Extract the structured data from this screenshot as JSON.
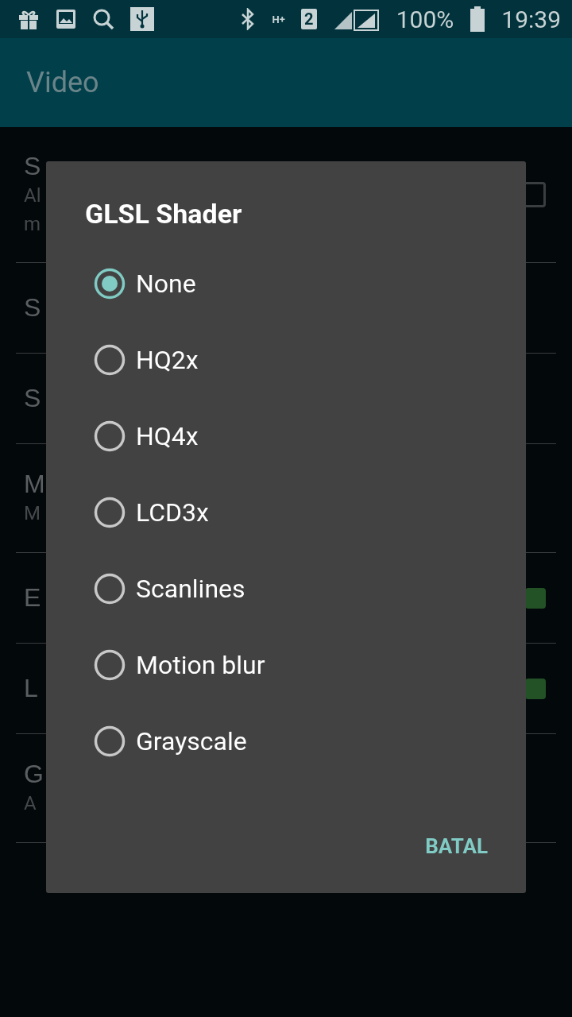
{
  "status_bar": {
    "network": "H+",
    "sim": "2",
    "battery": "100%",
    "time": "19:39"
  },
  "app_bar": {
    "title": "Video"
  },
  "settings": [
    {
      "title": "S",
      "summary": [
        "Al",
        "m"
      ],
      "kind": "checkbox",
      "checked": false
    },
    {
      "title": "S",
      "kind": "plain"
    },
    {
      "title": "S",
      "kind": "plain"
    },
    {
      "title": "M",
      "summary": [
        "M"
      ],
      "kind": "plain"
    },
    {
      "title": "E",
      "kind": "checkbox",
      "checked": true
    },
    {
      "title": "L",
      "kind": "checkbox",
      "checked": true
    },
    {
      "title": "G",
      "summary": [
        "A"
      ],
      "kind": "plain"
    }
  ],
  "dialog": {
    "title": "GLSL Shader",
    "options": [
      {
        "label": "None",
        "selected": true
      },
      {
        "label": "HQ2x",
        "selected": false
      },
      {
        "label": "HQ4x",
        "selected": false
      },
      {
        "label": "LCD3x",
        "selected": false
      },
      {
        "label": "Scanlines",
        "selected": false
      },
      {
        "label": "Motion blur",
        "selected": false
      },
      {
        "label": "Grayscale",
        "selected": false
      }
    ],
    "button": "BATAL"
  }
}
